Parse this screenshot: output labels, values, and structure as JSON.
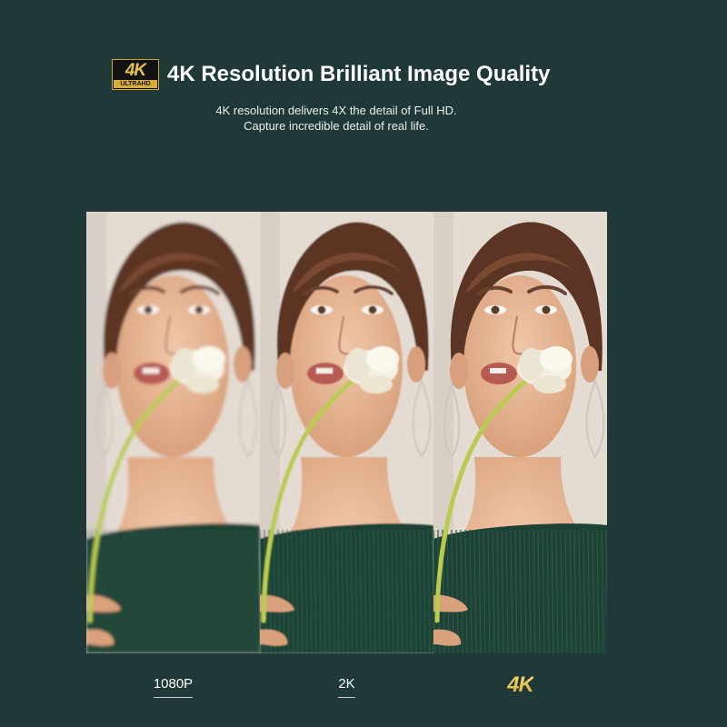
{
  "badge": {
    "big": "4K",
    "small": "ULTRAHD"
  },
  "headline": "4K Resolution Brilliant Image Quality",
  "subtitle": {
    "line1": "4K resolution delivers 4X the detail of Full HD.",
    "line2": "Capture incredible detail of real life."
  },
  "panels": [
    {
      "label": "1080P",
      "quality": "blurred"
    },
    {
      "label": "2K",
      "quality": "medium"
    },
    {
      "label": "4K",
      "quality": "sharp"
    }
  ],
  "colors": {
    "background": "#1f3939",
    "gold": "#e9c548",
    "sweater": "#1f4236"
  }
}
